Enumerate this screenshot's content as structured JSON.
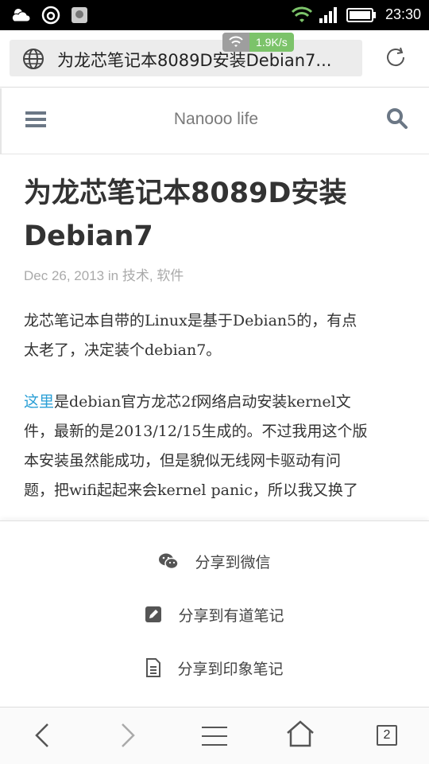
{
  "status_bar": {
    "time": "23:30",
    "icons": [
      "weather-icon",
      "netease-icon",
      "app-icon",
      "wifi-icon",
      "signal-icon",
      "battery-icon"
    ]
  },
  "browser": {
    "url_title": "为龙芯笔记本8089D安装Debian7...",
    "speed": "1.9K/s"
  },
  "site": {
    "title": "Nanooo life"
  },
  "article": {
    "title_line1": "为龙芯笔记本8089D安装",
    "title_line2": "Debian7",
    "date": "Dec 26, 2013",
    "in_word": "in",
    "category1": "技术",
    "category2": "软件",
    "para1_line1": "龙芯笔记本自带的Linux是基于Debian5的，有点",
    "para1_line2": "太老了，决定装个debian7。",
    "para2_link": "这里",
    "para2_line1_rest": "是debian官方龙芯2f网络启动安装kernel文",
    "para2_line2": "件，最新的是2013/12/15生成的。不过我用这个版",
    "para2_line3": "本安装虽然能成功，但是貌似无线网卡驱动有问",
    "para2_line4": "题，把wifi起起来会kernel panic，所以我又换了"
  },
  "share": {
    "wechat": "分享到微信",
    "youdao": "分享到有道笔记",
    "evernote": "分享到印象笔记"
  },
  "bottom_nav": {
    "tab_count": "2"
  },
  "colors": {
    "link": "#2a9fd6",
    "speed_badge": "#7cc36a",
    "status_bar": "#000000"
  }
}
